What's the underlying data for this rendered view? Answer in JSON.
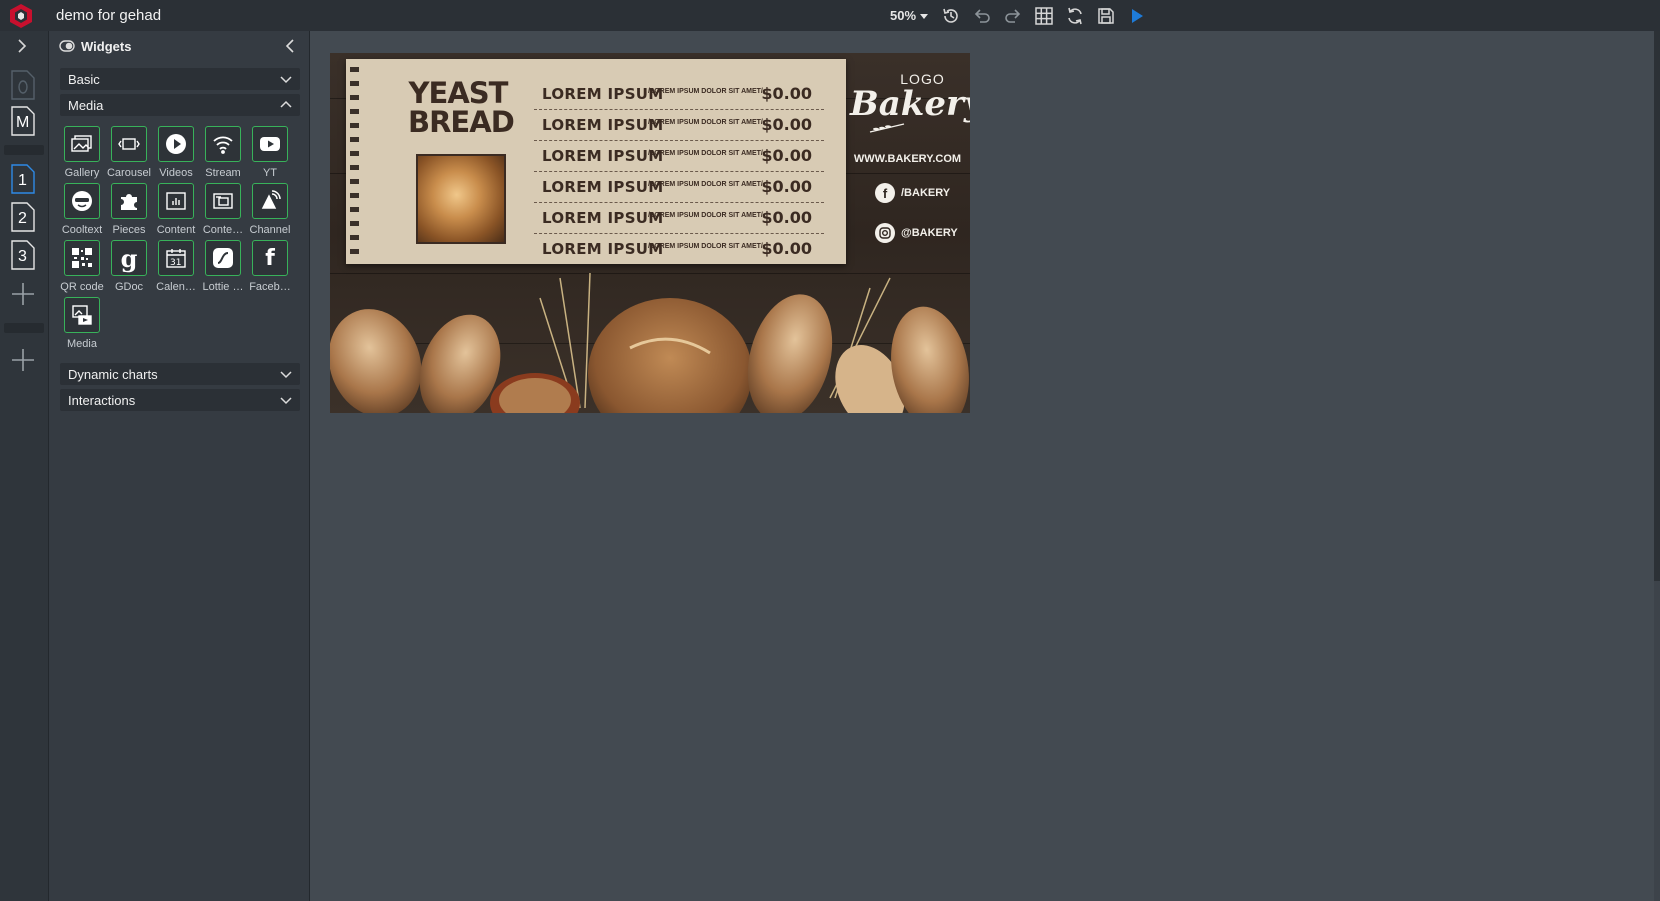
{
  "app": {
    "title": "demo for gehad"
  },
  "toolbar": {
    "zoom": "50%",
    "buttons": [
      "history-icon",
      "undo-icon",
      "redo-icon",
      "grid-icon",
      "refresh-icon",
      "save-icon",
      "play-icon"
    ]
  },
  "rail": {
    "pages": [
      {
        "label": ""
      },
      {
        "label": "M"
      },
      {
        "label": "1"
      },
      {
        "label": "2"
      },
      {
        "label": "3"
      }
    ]
  },
  "panel": {
    "title": "Widgets",
    "sections": [
      {
        "label": "Basic"
      },
      {
        "label": "Media"
      },
      {
        "label": "Dynamic charts"
      },
      {
        "label": "Interactions"
      }
    ],
    "media_widgets": [
      {
        "label": "Gallery",
        "icon": "gallery-icon"
      },
      {
        "label": "Carousel",
        "icon": "carousel-icon"
      },
      {
        "label": "Videos",
        "icon": "video-play-icon"
      },
      {
        "label": "Stream",
        "icon": "wifi-icon"
      },
      {
        "label": "YT",
        "icon": "youtube-icon"
      },
      {
        "label": "Cooltext",
        "icon": "cooltext-icon"
      },
      {
        "label": "Pieces",
        "icon": "puzzle-icon"
      },
      {
        "label": "Content",
        "icon": "content-icon"
      },
      {
        "label": "Conte…",
        "icon": "content-alt-icon"
      },
      {
        "label": "Channel",
        "icon": "channel-icon"
      },
      {
        "label": "QR code",
        "icon": "qr-code-icon"
      },
      {
        "label": "GDoc",
        "icon": "google-icon"
      },
      {
        "label": "Calen…",
        "icon": "calendar-icon"
      },
      {
        "label": "Lottie …",
        "icon": "lottie-icon"
      },
      {
        "label": "Faceb…",
        "icon": "facebook-icon"
      },
      {
        "label": "Media",
        "icon": "media-icon"
      }
    ]
  },
  "banner": {
    "title_line1": "YEAST",
    "title_line2": "BREAD",
    "menu_items": [
      {
        "name": "LOREM IPSUM",
        "desc": "/LOREM IPSUM DOLOR SIT AMET/",
        "price": "$0.00"
      },
      {
        "name": "LOREM IPSUM",
        "desc": "/LOREM IPSUM DOLOR SIT AMET/",
        "price": "$0.00"
      },
      {
        "name": "LOREM IPSUM",
        "desc": "/LOREM IPSUM DOLOR SIT AMET/",
        "price": "$0.00"
      },
      {
        "name": "LOREM IPSUM",
        "desc": "/LOREM IPSUM DOLOR SIT AMET/",
        "price": "$0.00"
      },
      {
        "name": "LOREM IPSUM",
        "desc": "/LOREM IPSUM DOLOR SIT AMET/",
        "price": "$0.00"
      },
      {
        "name": "LOREM IPSUM",
        "desc": "/LOREM IPSUM DOLOR SIT AMET/",
        "price": "$0.00"
      }
    ],
    "logo_word": "LOGO",
    "brand": "Bakery",
    "website": "WWW.BAKERY.COM",
    "facebook": "/BAKERY",
    "instagram": "@BAKERY"
  }
}
